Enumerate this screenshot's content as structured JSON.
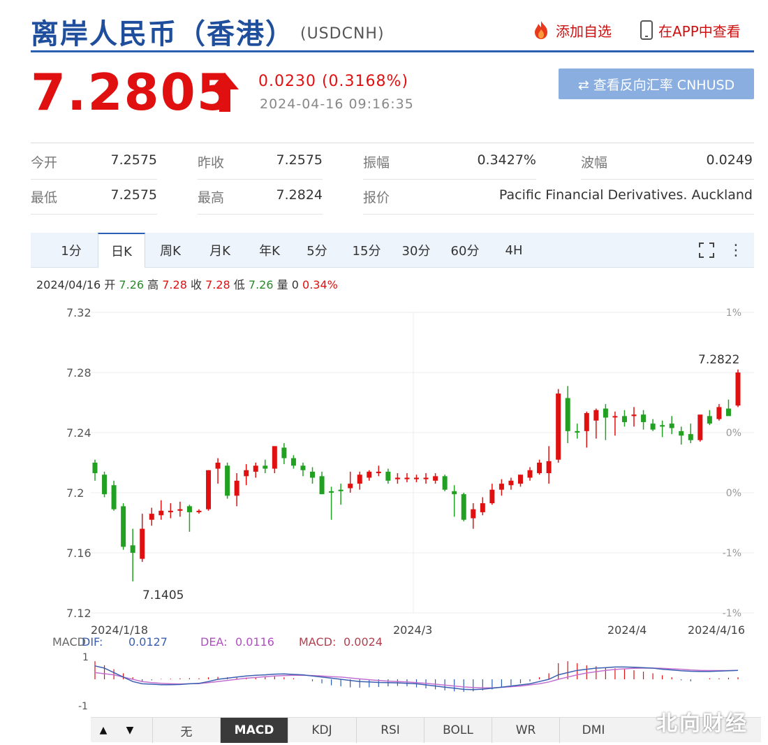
{
  "header": {
    "title": "离岸人民币（香港）",
    "code": "(USDCNH)",
    "add_watchlist": "添加自选",
    "view_in_app": "在APP中查看"
  },
  "quote": {
    "price": "7.2805",
    "change": "0.0230 (0.3168%)",
    "timestamp": "2024-04-16 09:16:35",
    "reverse_button": "⇄ 查看反向汇率 CNHUSD"
  },
  "stats": [
    {
      "label": "今开",
      "value": "7.2575"
    },
    {
      "label": "昨收",
      "value": "7.2575"
    },
    {
      "label": "振幅",
      "value": "0.3427%"
    },
    {
      "label": "波幅",
      "value": "0.0249"
    },
    {
      "label": "最低",
      "value": "7.2575"
    },
    {
      "label": "最高",
      "value": "7.2824"
    },
    {
      "label": "报价",
      "value": "Pacific Financial Derivatives. Auckland"
    }
  ],
  "tabs": [
    "1分",
    "日K",
    "周K",
    "月K",
    "年K",
    "5分",
    "15分",
    "30分",
    "60分",
    "4H"
  ],
  "active_tab": "日K",
  "info_line": {
    "date": "2024/04/16",
    "open_label": "开",
    "open": "7.26",
    "high_label": "高",
    "high": "7.28",
    "close_label": "收",
    "close": "7.28",
    "low_label": "低",
    "low": "7.26",
    "volume_label": "量",
    "volume": "0",
    "pct": "0.34%"
  },
  "colors": {
    "up": "#e01010",
    "down": "#22a022",
    "accent": "#2b5fb3"
  },
  "chart_data": {
    "type": "candlestick",
    "y_left_ticks": [
      "7.32",
      "7.28",
      "7.24",
      "7.2",
      "7.16",
      "7.12"
    ],
    "y_right_ticks": [
      "1%",
      "",
      "0%",
      "0%",
      "-1%",
      "-1%"
    ],
    "x_labels": [
      "2024/1/18",
      "2024/3",
      "2024/4",
      "2024/4/16"
    ],
    "ylim": [
      7.12,
      7.32
    ],
    "annotation_low": "7.1405",
    "annotation_last": "7.2822",
    "grid": true,
    "candles": [
      {
        "o": 7.22,
        "h": 7.222,
        "l": 7.208,
        "c": 7.213
      },
      {
        "o": 7.212,
        "h": 7.214,
        "l": 7.197,
        "c": 7.199
      },
      {
        "o": 7.205,
        "h": 7.208,
        "l": 7.188,
        "c": 7.189
      },
      {
        "o": 7.191,
        "h": 7.193,
        "l": 7.162,
        "c": 7.164
      },
      {
        "o": 7.165,
        "h": 7.176,
        "l": 7.141,
        "c": 7.16
      },
      {
        "o": 7.156,
        "h": 7.186,
        "l": 7.154,
        "c": 7.176
      },
      {
        "o": 7.182,
        "h": 7.19,
        "l": 7.178,
        "c": 7.186
      },
      {
        "o": 7.185,
        "h": 7.195,
        "l": 7.182,
        "c": 7.188
      },
      {
        "o": 7.187,
        "h": 7.193,
        "l": 7.183,
        "c": 7.188
      },
      {
        "o": 7.188,
        "h": 7.194,
        "l": 7.184,
        "c": 7.189
      },
      {
        "o": 7.191,
        "h": 7.192,
        "l": 7.174,
        "c": 7.187
      },
      {
        "o": 7.187,
        "h": 7.189,
        "l": 7.186,
        "c": 7.188
      },
      {
        "o": 7.189,
        "h": 7.215,
        "l": 7.188,
        "c": 7.215
      },
      {
        "o": 7.216,
        "h": 7.223,
        "l": 7.206,
        "c": 7.22
      },
      {
        "o": 7.218,
        "h": 7.22,
        "l": 7.196,
        "c": 7.198
      },
      {
        "o": 7.198,
        "h": 7.213,
        "l": 7.191,
        "c": 7.208
      },
      {
        "o": 7.211,
        "h": 7.219,
        "l": 7.205,
        "c": 7.215
      },
      {
        "o": 7.214,
        "h": 7.22,
        "l": 7.21,
        "c": 7.218
      },
      {
        "o": 7.218,
        "h": 7.222,
        "l": 7.213,
        "c": 7.216
      },
      {
        "o": 7.216,
        "h": 7.227,
        "l": 7.213,
        "c": 7.231
      },
      {
        "o": 7.23,
        "h": 7.233,
        "l": 7.219,
        "c": 7.223
      },
      {
        "o": 7.223,
        "h": 7.225,
        "l": 7.216,
        "c": 7.218
      },
      {
        "o": 7.218,
        "h": 7.22,
        "l": 7.211,
        "c": 7.215
      },
      {
        "o": 7.214,
        "h": 7.217,
        "l": 7.206,
        "c": 7.21
      },
      {
        "o": 7.211,
        "h": 7.214,
        "l": 7.199,
        "c": 7.199
      },
      {
        "o": 7.201,
        "h": 7.204,
        "l": 7.182,
        "c": 7.2
      },
      {
        "o": 7.202,
        "h": 7.206,
        "l": 7.192,
        "c": 7.201
      },
      {
        "o": 7.203,
        "h": 7.214,
        "l": 7.2,
        "c": 7.206
      },
      {
        "o": 7.206,
        "h": 7.214,
        "l": 7.202,
        "c": 7.212
      },
      {
        "o": 7.21,
        "h": 7.215,
        "l": 7.208,
        "c": 7.214
      },
      {
        "o": 7.213,
        "h": 7.218,
        "l": 7.211,
        "c": 7.214
      },
      {
        "o": 7.214,
        "h": 7.216,
        "l": 7.206,
        "c": 7.208
      },
      {
        "o": 7.209,
        "h": 7.213,
        "l": 7.206,
        "c": 7.21
      },
      {
        "o": 7.209,
        "h": 7.213,
        "l": 7.207,
        "c": 7.21
      },
      {
        "o": 7.209,
        "h": 7.212,
        "l": 7.207,
        "c": 7.21
      },
      {
        "o": 7.209,
        "h": 7.213,
        "l": 7.206,
        "c": 7.21
      },
      {
        "o": 7.208,
        "h": 7.213,
        "l": 7.206,
        "c": 7.211
      },
      {
        "o": 7.211,
        "h": 7.212,
        "l": 7.201,
        "c": 7.202
      },
      {
        "o": 7.201,
        "h": 7.205,
        "l": 7.184,
        "c": 7.199
      },
      {
        "o": 7.199,
        "h": 7.2,
        "l": 7.181,
        "c": 7.182
      },
      {
        "o": 7.183,
        "h": 7.193,
        "l": 7.176,
        "c": 7.189
      },
      {
        "o": 7.187,
        "h": 7.197,
        "l": 7.185,
        "c": 7.193
      },
      {
        "o": 7.193,
        "h": 7.206,
        "l": 7.192,
        "c": 7.202
      },
      {
        "o": 7.202,
        "h": 7.209,
        "l": 7.198,
        "c": 7.206
      },
      {
        "o": 7.205,
        "h": 7.21,
        "l": 7.202,
        "c": 7.208
      },
      {
        "o": 7.206,
        "h": 7.212,
        "l": 7.204,
        "c": 7.212
      },
      {
        "o": 7.21,
        "h": 7.217,
        "l": 7.208,
        "c": 7.215
      },
      {
        "o": 7.213,
        "h": 7.222,
        "l": 7.212,
        "c": 7.22
      },
      {
        "o": 7.213,
        "h": 7.231,
        "l": 7.206,
        "c": 7.221
      },
      {
        "o": 7.222,
        "h": 7.269,
        "l": 7.22,
        "c": 7.266
      },
      {
        "o": 7.263,
        "h": 7.271,
        "l": 7.233,
        "c": 7.241
      },
      {
        "o": 7.241,
        "h": 7.246,
        "l": 7.236,
        "c": 7.24
      },
      {
        "o": 7.241,
        "h": 7.254,
        "l": 7.23,
        "c": 7.253
      },
      {
        "o": 7.248,
        "h": 7.256,
        "l": 7.236,
        "c": 7.255
      },
      {
        "o": 7.256,
        "h": 7.259,
        "l": 7.235,
        "c": 7.25
      },
      {
        "o": 7.251,
        "h": 7.254,
        "l": 7.238,
        "c": 7.251
      },
      {
        "o": 7.251,
        "h": 7.255,
        "l": 7.244,
        "c": 7.247
      },
      {
        "o": 7.251,
        "h": 7.257,
        "l": 7.244,
        "c": 7.252
      },
      {
        "o": 7.252,
        "h": 7.255,
        "l": 7.242,
        "c": 7.247
      },
      {
        "o": 7.246,
        "h": 7.249,
        "l": 7.241,
        "c": 7.242
      },
      {
        "o": 7.245,
        "h": 7.248,
        "l": 7.237,
        "c": 7.244
      },
      {
        "o": 7.246,
        "h": 7.251,
        "l": 7.239,
        "c": 7.243
      },
      {
        "o": 7.241,
        "h": 7.244,
        "l": 7.232,
        "c": 7.238
      },
      {
        "o": 7.239,
        "h": 7.246,
        "l": 7.233,
        "c": 7.235
      },
      {
        "o": 7.235,
        "h": 7.247,
        "l": 7.234,
        "c": 7.252
      },
      {
        "o": 7.251,
        "h": 7.255,
        "l": 7.245,
        "c": 7.246
      },
      {
        "o": 7.249,
        "h": 7.259,
        "l": 7.248,
        "c": 7.257
      },
      {
        "o": 7.256,
        "h": 7.262,
        "l": 7.252,
        "c": 7.251
      },
      {
        "o": 7.258,
        "h": 7.282,
        "l": 7.257,
        "c": 7.28
      }
    ]
  },
  "macd": {
    "title": "MACD",
    "dif_label": "DIF:",
    "dif": "0.0127",
    "dea_label": "DEA:",
    "dea": "0.0116",
    "macd_label": "MACD:",
    "macd": "0.0024",
    "y_top": "1",
    "y_bottom": "-1",
    "bars": [
      0.9,
      0.7,
      0.5,
      0.3,
      0.1,
      -0.1,
      -0.05,
      0.02,
      0.03,
      0.05,
      0.06,
      0.05,
      0.1,
      0.12,
      0.1,
      0.08,
      0.09,
      0.1,
      0.12,
      0.15,
      0.1,
      0.05,
      0.0,
      -0.1,
      -0.2,
      -0.3,
      -0.35,
      -0.4,
      -0.42,
      -0.4,
      -0.38,
      -0.35,
      -0.33,
      -0.35,
      -0.4,
      -0.45,
      -0.5,
      -0.55,
      -0.6,
      -0.62,
      -0.6,
      -0.55,
      -0.5,
      -0.4,
      -0.3,
      -0.2,
      -0.1,
      0.1,
      0.3,
      0.8,
      0.9,
      0.8,
      0.7,
      0.65,
      0.6,
      0.55,
      0.5,
      0.45,
      0.38,
      0.3,
      0.2,
      0.1,
      -0.05,
      -0.1,
      0.0,
      0.05,
      0.05,
      0.08,
      0.1
    ],
    "dif_line": [
      0.6,
      0.5,
      0.3,
      0.1,
      -0.1,
      -0.2,
      -0.22,
      -0.24,
      -0.24,
      -0.23,
      -0.2,
      -0.18,
      -0.1,
      0.0,
      0.05,
      0.1,
      0.15,
      0.18,
      0.2,
      0.23,
      0.24,
      0.22,
      0.2,
      0.15,
      0.1,
      0.05,
      0.0,
      -0.05,
      -0.1,
      -0.12,
      -0.14,
      -0.15,
      -0.16,
      -0.18,
      -0.2,
      -0.25,
      -0.3,
      -0.35,
      -0.4,
      -0.45,
      -0.46,
      -0.44,
      -0.4,
      -0.35,
      -0.3,
      -0.25,
      -0.2,
      -0.1,
      0.0,
      0.2,
      0.3,
      0.4,
      0.45,
      0.5,
      0.52,
      0.55,
      0.55,
      0.54,
      0.52,
      0.5,
      0.45,
      0.42,
      0.38,
      0.36,
      0.35,
      0.35,
      0.37,
      0.38,
      0.4
    ],
    "dea_line": [
      0.3,
      0.25,
      0.2,
      0.1,
      0.0,
      -0.1,
      -0.15,
      -0.18,
      -0.2,
      -0.21,
      -0.2,
      -0.19,
      -0.15,
      -0.1,
      -0.05,
      0.0,
      0.05,
      0.08,
      0.12,
      0.15,
      0.17,
      0.18,
      0.18,
      0.17,
      0.15,
      0.12,
      0.1,
      0.06,
      0.02,
      -0.02,
      -0.05,
      -0.08,
      -0.1,
      -0.12,
      -0.15,
      -0.18,
      -0.22,
      -0.26,
      -0.3,
      -0.34,
      -0.37,
      -0.38,
      -0.38,
      -0.36,
      -0.33,
      -0.3,
      -0.25,
      -0.2,
      -0.12,
      0.0,
      0.1,
      0.2,
      0.28,
      0.34,
      0.4,
      0.44,
      0.47,
      0.49,
      0.5,
      0.5,
      0.49,
      0.47,
      0.45,
      0.42,
      0.4,
      0.39,
      0.39,
      0.39,
      0.4
    ]
  },
  "bottom_tabs": [
    "无",
    "MACD",
    "KDJ",
    "RSI",
    "BOLL",
    "WR",
    "DMI"
  ],
  "active_indicator": "MACD",
  "watermark": "北向财经"
}
